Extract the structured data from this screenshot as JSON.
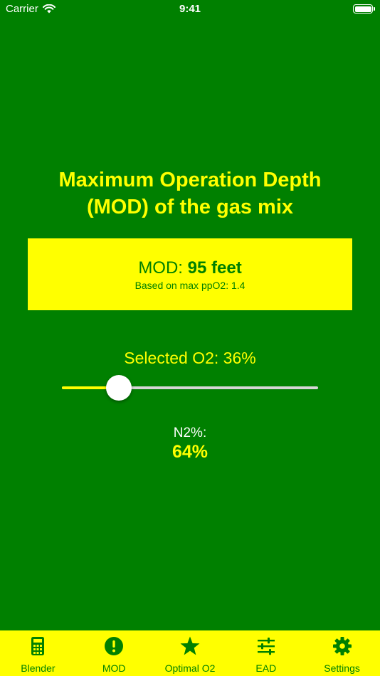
{
  "status_bar": {
    "carrier": "Carrier",
    "time": "9:41"
  },
  "title": {
    "line1": "Maximum Operation Depth",
    "line2": "(MOD) of the gas mix"
  },
  "result": {
    "prefix": "MOD: ",
    "value": "95 feet",
    "subtitle": "Based on max ppO2: 1.4"
  },
  "slider": {
    "label": "Selected O2: 36%",
    "value_percent": 36,
    "min": 21,
    "max": 100
  },
  "n2": {
    "label": "N2%:",
    "value": "64%"
  },
  "tabs": [
    {
      "label": "Blender",
      "icon": "calculator-icon"
    },
    {
      "label": "MOD",
      "icon": "exclamation-circle-icon"
    },
    {
      "label": "Optimal O2",
      "icon": "star-icon"
    },
    {
      "label": "EAD",
      "icon": "sliders-icon"
    },
    {
      "label": "Settings",
      "icon": "gear-icon"
    }
  ],
  "colors": {
    "background": "#008000",
    "accent": "#ffff00",
    "text_light": "#ffffff"
  }
}
